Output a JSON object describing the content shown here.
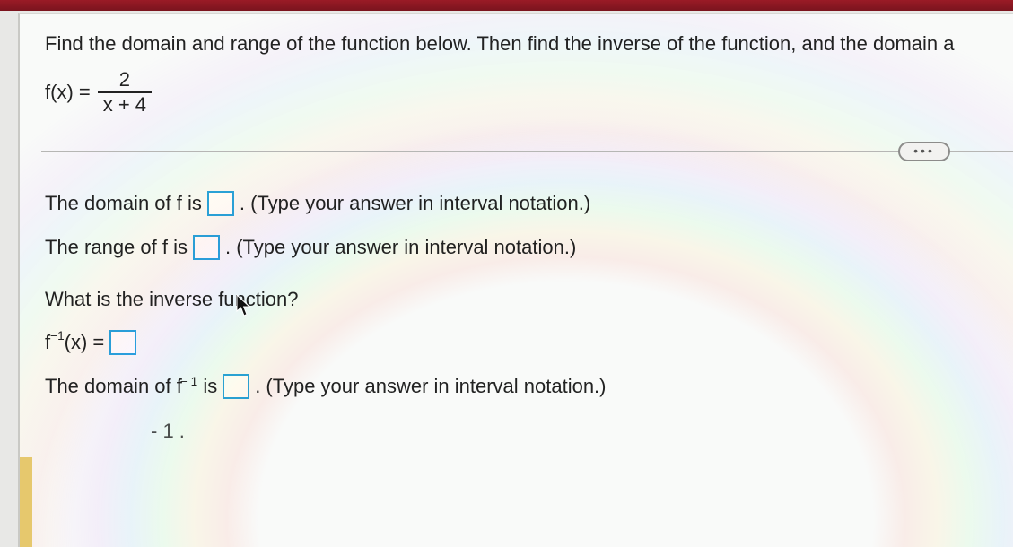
{
  "prompt": "Find the domain and range of the function below.  Then find the inverse of the function, and the domain a",
  "formula": {
    "lhs": "f(x) =",
    "numerator": "2",
    "denominator": "x + 4"
  },
  "more_button": "•••",
  "lines": {
    "domain_f_pre": "The domain of f is",
    "domain_f_post": ". (Type your answer in interval notation.)",
    "range_f_pre": "The range of f is",
    "range_f_post": ". (Type your answer in interval notation.)",
    "inverse_q": "What is the inverse function?",
    "inverse_lhs_a": "f",
    "inverse_lhs_exp": "−1",
    "inverse_lhs_b": "(x) =",
    "domain_inv_pre_a": "The domain of f",
    "domain_inv_pre_exp": "− 1",
    "domain_inv_pre_b": " is",
    "domain_inv_post": ". (Type your answer in interval notation.)",
    "truncated": "- 1 ."
  }
}
